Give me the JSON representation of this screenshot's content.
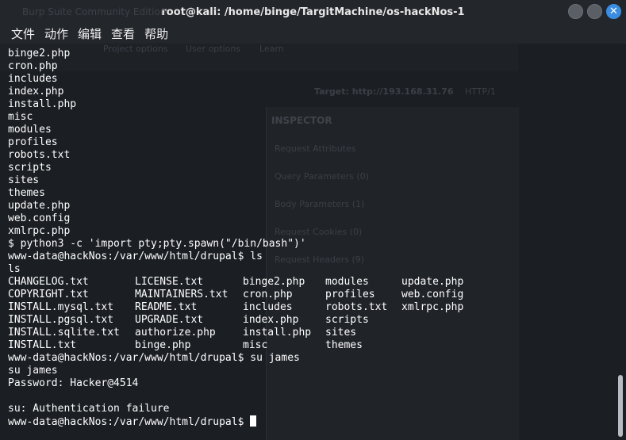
{
  "window": {
    "title": "root@kali: /home/binge/TargitMachine/os-hackNos-1",
    "ghost_title": "Burp Suite Community Edition"
  },
  "menu": [
    "文件",
    "动作",
    "编辑",
    "查看",
    "帮助"
  ],
  "ghost_app": {
    "tabs": [
      "Project options",
      "User options",
      "Learn"
    ],
    "target": "Target: http://193.168.31.76",
    "http": "HTTP/1",
    "inspector_title": "INSPECTOR",
    "rows": [
      "Request Attributes",
      "Query Parameters (0)",
      "Body Parameters (1)",
      "Request Cookies (0)",
      "Request Headers (9)"
    ]
  },
  "terminal": {
    "lines_before": [
      "binge2.php",
      "cron.php",
      "includes",
      "index.php",
      "install.php",
      "misc",
      "modules",
      "profiles",
      "robots.txt",
      "scripts",
      "sites",
      "themes",
      "update.php",
      "web.config",
      "xmlrpc.php",
      "$ python3 -c 'import pty;pty.spawn(\"/bin/bash\")'",
      "www-data@hackNos:/var/www/html/drupal$ ls",
      "ls"
    ],
    "ls_rows": [
      [
        "CHANGELOG.txt",
        "LICENSE.txt",
        "binge2.php",
        "modules",
        "update.php"
      ],
      [
        "COPYRIGHT.txt",
        "MAINTAINERS.txt",
        "cron.php",
        "profiles",
        "web.config"
      ],
      [
        "INSTALL.mysql.txt",
        "README.txt",
        "includes",
        "robots.txt",
        "xmlrpc.php"
      ],
      [
        "INSTALL.pgsql.txt",
        "UPGRADE.txt",
        "index.php",
        "scripts",
        ""
      ],
      [
        "INSTALL.sqlite.txt",
        "authorize.php",
        "install.php",
        "sites",
        ""
      ],
      [
        "INSTALL.txt",
        "binge.php",
        "misc",
        "themes",
        ""
      ]
    ],
    "lines_after": [
      "www-data@hackNos:/var/www/html/drupal$ su james",
      "su james",
      "Password: Hacker@4514",
      "",
      "su: Authentication failure"
    ],
    "prompt": "www-data@hackNos:/var/www/html/drupal$ "
  }
}
